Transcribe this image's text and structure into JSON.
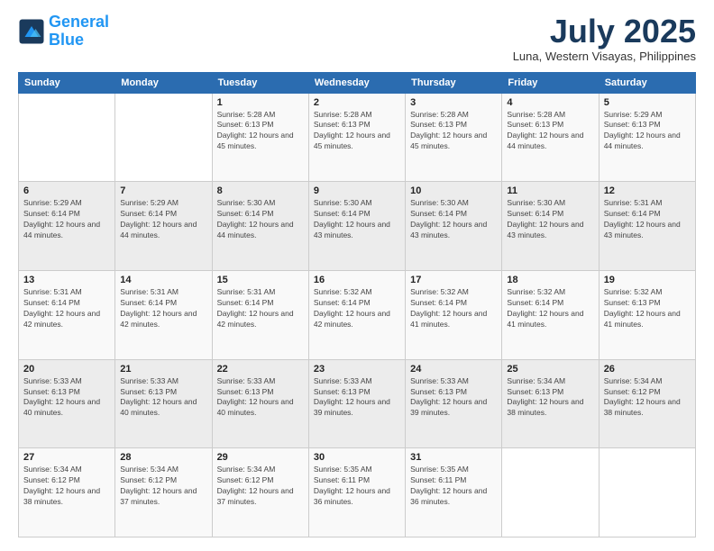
{
  "header": {
    "logo_line1": "General",
    "logo_line2": "Blue",
    "month": "July 2025",
    "location": "Luna, Western Visayas, Philippines"
  },
  "weekdays": [
    "Sunday",
    "Monday",
    "Tuesday",
    "Wednesday",
    "Thursday",
    "Friday",
    "Saturday"
  ],
  "weeks": [
    [
      {
        "day": "",
        "sunrise": "",
        "sunset": "",
        "daylight": ""
      },
      {
        "day": "",
        "sunrise": "",
        "sunset": "",
        "daylight": ""
      },
      {
        "day": "1",
        "sunrise": "Sunrise: 5:28 AM",
        "sunset": "Sunset: 6:13 PM",
        "daylight": "Daylight: 12 hours and 45 minutes."
      },
      {
        "day": "2",
        "sunrise": "Sunrise: 5:28 AM",
        "sunset": "Sunset: 6:13 PM",
        "daylight": "Daylight: 12 hours and 45 minutes."
      },
      {
        "day": "3",
        "sunrise": "Sunrise: 5:28 AM",
        "sunset": "Sunset: 6:13 PM",
        "daylight": "Daylight: 12 hours and 45 minutes."
      },
      {
        "day": "4",
        "sunrise": "Sunrise: 5:28 AM",
        "sunset": "Sunset: 6:13 PM",
        "daylight": "Daylight: 12 hours and 44 minutes."
      },
      {
        "day": "5",
        "sunrise": "Sunrise: 5:29 AM",
        "sunset": "Sunset: 6:13 PM",
        "daylight": "Daylight: 12 hours and 44 minutes."
      }
    ],
    [
      {
        "day": "6",
        "sunrise": "Sunrise: 5:29 AM",
        "sunset": "Sunset: 6:14 PM",
        "daylight": "Daylight: 12 hours and 44 minutes."
      },
      {
        "day": "7",
        "sunrise": "Sunrise: 5:29 AM",
        "sunset": "Sunset: 6:14 PM",
        "daylight": "Daylight: 12 hours and 44 minutes."
      },
      {
        "day": "8",
        "sunrise": "Sunrise: 5:30 AM",
        "sunset": "Sunset: 6:14 PM",
        "daylight": "Daylight: 12 hours and 44 minutes."
      },
      {
        "day": "9",
        "sunrise": "Sunrise: 5:30 AM",
        "sunset": "Sunset: 6:14 PM",
        "daylight": "Daylight: 12 hours and 43 minutes."
      },
      {
        "day": "10",
        "sunrise": "Sunrise: 5:30 AM",
        "sunset": "Sunset: 6:14 PM",
        "daylight": "Daylight: 12 hours and 43 minutes."
      },
      {
        "day": "11",
        "sunrise": "Sunrise: 5:30 AM",
        "sunset": "Sunset: 6:14 PM",
        "daylight": "Daylight: 12 hours and 43 minutes."
      },
      {
        "day": "12",
        "sunrise": "Sunrise: 5:31 AM",
        "sunset": "Sunset: 6:14 PM",
        "daylight": "Daylight: 12 hours and 43 minutes."
      }
    ],
    [
      {
        "day": "13",
        "sunrise": "Sunrise: 5:31 AM",
        "sunset": "Sunset: 6:14 PM",
        "daylight": "Daylight: 12 hours and 42 minutes."
      },
      {
        "day": "14",
        "sunrise": "Sunrise: 5:31 AM",
        "sunset": "Sunset: 6:14 PM",
        "daylight": "Daylight: 12 hours and 42 minutes."
      },
      {
        "day": "15",
        "sunrise": "Sunrise: 5:31 AM",
        "sunset": "Sunset: 6:14 PM",
        "daylight": "Daylight: 12 hours and 42 minutes."
      },
      {
        "day": "16",
        "sunrise": "Sunrise: 5:32 AM",
        "sunset": "Sunset: 6:14 PM",
        "daylight": "Daylight: 12 hours and 42 minutes."
      },
      {
        "day": "17",
        "sunrise": "Sunrise: 5:32 AM",
        "sunset": "Sunset: 6:14 PM",
        "daylight": "Daylight: 12 hours and 41 minutes."
      },
      {
        "day": "18",
        "sunrise": "Sunrise: 5:32 AM",
        "sunset": "Sunset: 6:14 PM",
        "daylight": "Daylight: 12 hours and 41 minutes."
      },
      {
        "day": "19",
        "sunrise": "Sunrise: 5:32 AM",
        "sunset": "Sunset: 6:13 PM",
        "daylight": "Daylight: 12 hours and 41 minutes."
      }
    ],
    [
      {
        "day": "20",
        "sunrise": "Sunrise: 5:33 AM",
        "sunset": "Sunset: 6:13 PM",
        "daylight": "Daylight: 12 hours and 40 minutes."
      },
      {
        "day": "21",
        "sunrise": "Sunrise: 5:33 AM",
        "sunset": "Sunset: 6:13 PM",
        "daylight": "Daylight: 12 hours and 40 minutes."
      },
      {
        "day": "22",
        "sunrise": "Sunrise: 5:33 AM",
        "sunset": "Sunset: 6:13 PM",
        "daylight": "Daylight: 12 hours and 40 minutes."
      },
      {
        "day": "23",
        "sunrise": "Sunrise: 5:33 AM",
        "sunset": "Sunset: 6:13 PM",
        "daylight": "Daylight: 12 hours and 39 minutes."
      },
      {
        "day": "24",
        "sunrise": "Sunrise: 5:33 AM",
        "sunset": "Sunset: 6:13 PM",
        "daylight": "Daylight: 12 hours and 39 minutes."
      },
      {
        "day": "25",
        "sunrise": "Sunrise: 5:34 AM",
        "sunset": "Sunset: 6:13 PM",
        "daylight": "Daylight: 12 hours and 38 minutes."
      },
      {
        "day": "26",
        "sunrise": "Sunrise: 5:34 AM",
        "sunset": "Sunset: 6:12 PM",
        "daylight": "Daylight: 12 hours and 38 minutes."
      }
    ],
    [
      {
        "day": "27",
        "sunrise": "Sunrise: 5:34 AM",
        "sunset": "Sunset: 6:12 PM",
        "daylight": "Daylight: 12 hours and 38 minutes."
      },
      {
        "day": "28",
        "sunrise": "Sunrise: 5:34 AM",
        "sunset": "Sunset: 6:12 PM",
        "daylight": "Daylight: 12 hours and 37 minutes."
      },
      {
        "day": "29",
        "sunrise": "Sunrise: 5:34 AM",
        "sunset": "Sunset: 6:12 PM",
        "daylight": "Daylight: 12 hours and 37 minutes."
      },
      {
        "day": "30",
        "sunrise": "Sunrise: 5:35 AM",
        "sunset": "Sunset: 6:11 PM",
        "daylight": "Daylight: 12 hours and 36 minutes."
      },
      {
        "day": "31",
        "sunrise": "Sunrise: 5:35 AM",
        "sunset": "Sunset: 6:11 PM",
        "daylight": "Daylight: 12 hours and 36 minutes."
      },
      {
        "day": "",
        "sunrise": "",
        "sunset": "",
        "daylight": ""
      },
      {
        "day": "",
        "sunrise": "",
        "sunset": "",
        "daylight": ""
      }
    ]
  ]
}
